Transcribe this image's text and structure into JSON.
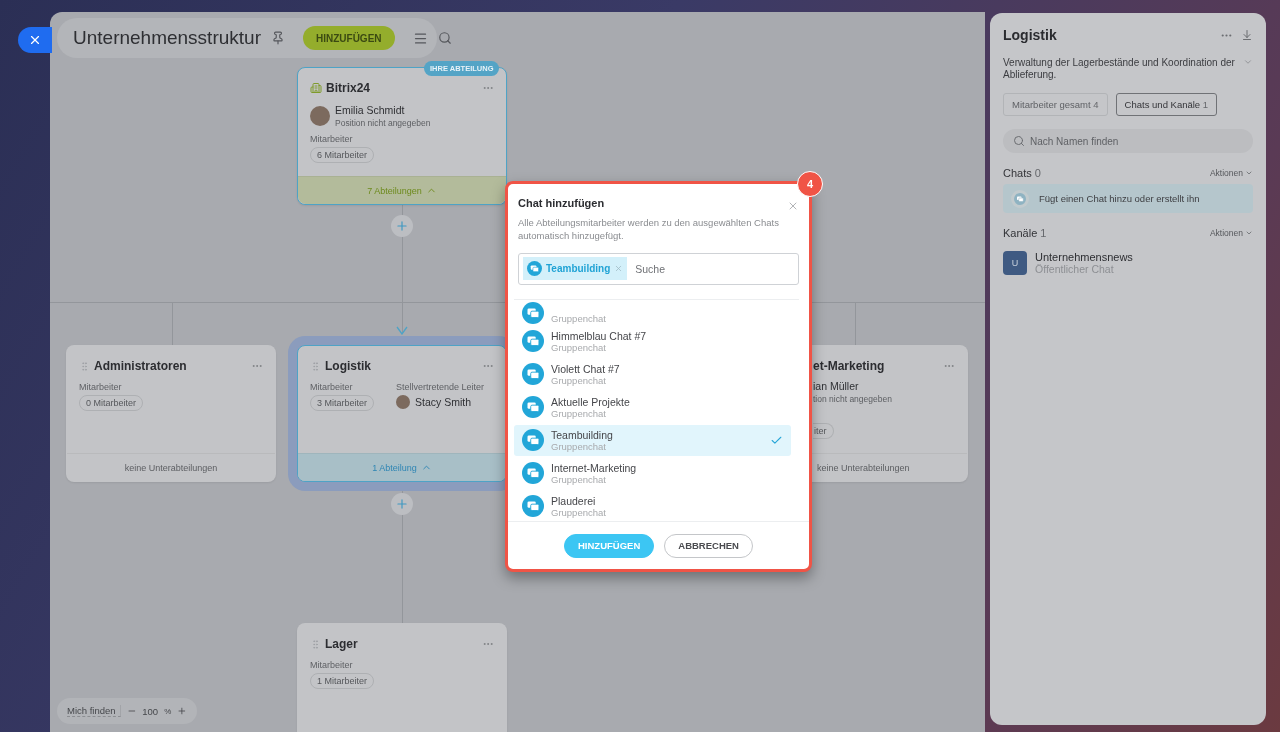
{
  "toolbar": {
    "title": "Unternehmensstruktur",
    "add_button": "HINZUFÜGEN"
  },
  "org_chart": {
    "root": {
      "name": "Bitrix24",
      "badge": "IHRE ABTEILUNG",
      "head_name": "Emilia Schmidt",
      "head_position": "Position nicht angegeben",
      "employees_label": "Mitarbeiter",
      "employees": "6 Mitarbeiter",
      "subdepartments": "7 Abteilungen",
      "expanded": true
    },
    "departments": [
      {
        "name": "Administratoren",
        "employees_label": "Mitarbeiter",
        "employees": "0 Mitarbeiter",
        "subdepartments": "keine Unterabteilungen",
        "selected": false
      },
      {
        "name": "Logistik",
        "employees_label": "Mitarbeiter",
        "employees": "3 Mitarbeiter",
        "deputy_label": "Stellvertretende Leiter",
        "deputy": "Stacy Smith",
        "subdepartments": "1 Abteilung",
        "selected": true,
        "expanded": true
      }
    ],
    "partial_department": {
      "name": "et-Marketing",
      "head_name": "ian Müller",
      "head_position": "tion nicht angegeben",
      "employees": "iter",
      "subdepartments": "keine Unterabteilungen"
    },
    "child_department": {
      "name": "Lager",
      "employees_label": "Mitarbeiter",
      "employees": "1 Mitarbeiter"
    }
  },
  "zoom_bar": {
    "find_me": "Mich finden",
    "zoom": "100",
    "unit": "%"
  },
  "side_panel": {
    "title": "Logistik",
    "description": "Verwaltung der Lagerbestände und Koordination der Ablieferung.",
    "tabs": [
      {
        "label": "Mitarbeiter gesamt",
        "count": "4",
        "selected": false
      },
      {
        "label": "Chats und Kanäle",
        "count": "1",
        "selected": true
      }
    ],
    "search": {
      "placeholder": "Nach Namen finden"
    },
    "chats": {
      "title": "Chats",
      "count": "0",
      "action": "Aktionen",
      "hint": "Fügt einen Chat hinzu oder erstellt ihn"
    },
    "channels": {
      "title": "Kanäle",
      "count": "1",
      "action": "Aktionen",
      "items": [
        {
          "initial": "U",
          "name": "Unternehmensnews",
          "type": "Öffentlicher Chat"
        }
      ]
    }
  },
  "dialog": {
    "step": "4",
    "title": "Chat hinzufügen",
    "description": "Alle Abteilungsmitarbeiter werden zu den ausgewählten Chats automatisch hinzugefügt.",
    "tags": [
      {
        "label": "Teambuilding"
      }
    ],
    "search": {
      "placeholder": "Suche"
    },
    "items": [
      {
        "type": "Gruppenchat",
        "selected": false
      },
      {
        "name": "Himmelblau Chat #7",
        "type": "Gruppenchat",
        "selected": false
      },
      {
        "name": "Violett Chat #7",
        "type": "Gruppenchat",
        "selected": false
      },
      {
        "name": "Aktuelle Projekte",
        "type": "Gruppenchat",
        "selected": false
      },
      {
        "name": "Teambuilding",
        "type": "Gruppenchat",
        "selected": true
      },
      {
        "name": "Internet-Marketing",
        "type": "Gruppenchat",
        "selected": false
      },
      {
        "name": "Plauderei",
        "type": "Gruppenchat",
        "selected": false
      }
    ],
    "buttons": [
      {
        "label": "HINZUFÜGEN",
        "kind": "primary"
      },
      {
        "label": "ABBRECHEN",
        "kind": "secondary"
      }
    ]
  }
}
